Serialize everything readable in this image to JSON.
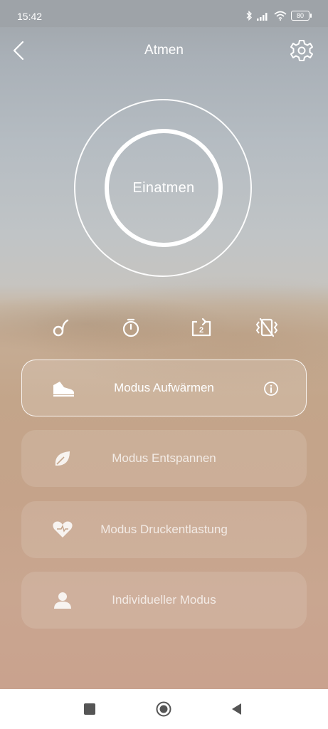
{
  "status_bar": {
    "time": "15:42",
    "battery_level": "80"
  },
  "header": {
    "title": "Atmen",
    "back_icon": "chevron-left-icon",
    "settings_icon": "gear-icon"
  },
  "breathing": {
    "phase_label": "Einatmen"
  },
  "controls": [
    {
      "icon": "music-note-icon"
    },
    {
      "icon": "timer-icon"
    },
    {
      "icon": "repeat-icon",
      "badge": "2"
    },
    {
      "icon": "vibration-off-icon"
    }
  ],
  "modes": [
    {
      "label": "Modus Aufwärmen",
      "icon": "shoe-icon",
      "active": true,
      "info_icon": "info-icon"
    },
    {
      "label": "Modus Entspannen",
      "icon": "leaf-icon",
      "active": false
    },
    {
      "label": "Modus Druckentlastung",
      "icon": "heart-icon",
      "active": false
    },
    {
      "label": "Individueller Modus",
      "icon": "person-icon",
      "active": false
    }
  ],
  "nav": [
    {
      "icon": "square-icon"
    },
    {
      "icon": "home-circle-icon"
    },
    {
      "icon": "back-triangle-icon"
    }
  ]
}
